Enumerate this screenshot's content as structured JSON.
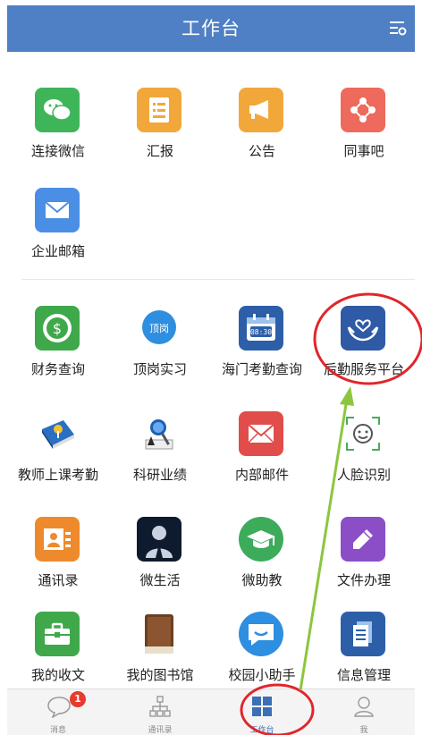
{
  "header": {
    "title": "工作台"
  },
  "section1": [
    {
      "label": "连接微信",
      "icon": "wechat-icon",
      "color": "#3fb55a"
    },
    {
      "label": "汇报",
      "icon": "report-icon",
      "color": "#f2a73b"
    },
    {
      "label": "公告",
      "icon": "megaphone-icon",
      "color": "#f2a73b"
    },
    {
      "label": "同事吧",
      "icon": "colleague-icon",
      "color": "#ee6a5c"
    },
    {
      "label": "企业邮箱",
      "icon": "mail-icon",
      "color": "#4b8ee6"
    }
  ],
  "section2": [
    {
      "label": "财务查询",
      "icon": "finance-icon"
    },
    {
      "label": "顶岗实习",
      "icon": "internship-icon",
      "badge_text": "顶岗"
    },
    {
      "label": "海门考勤查询",
      "icon": "attendance-icon",
      "clock_text": "08:30"
    },
    {
      "label": "后勤服务平台",
      "icon": "logistics-icon"
    },
    {
      "label": "教师上课考勤",
      "icon": "teacher-attendance-icon"
    },
    {
      "label": "科研业绩",
      "icon": "research-icon"
    },
    {
      "label": "内部邮件",
      "icon": "internal-mail-icon"
    },
    {
      "label": "人脸识别",
      "icon": "face-recognition-icon"
    },
    {
      "label": "通讯录",
      "icon": "contacts-icon"
    },
    {
      "label": "微生活",
      "icon": "micro-life-icon"
    },
    {
      "label": "微助教",
      "icon": "teaching-assistant-icon"
    },
    {
      "label": "文件办理",
      "icon": "file-handling-icon"
    },
    {
      "label": "我的收文",
      "icon": "received-docs-icon"
    },
    {
      "label": "我的图书馆",
      "icon": "library-icon"
    },
    {
      "label": "校园小助手",
      "icon": "campus-assistant-icon"
    },
    {
      "label": "信息管理",
      "icon": "info-management-icon"
    }
  ],
  "tabs": [
    {
      "label": "消息",
      "icon": "message-icon",
      "badge": "1"
    },
    {
      "label": "通讯录",
      "icon": "org-chart-icon"
    },
    {
      "label": "工作台",
      "icon": "workbench-icon",
      "active": true
    },
    {
      "label": "我",
      "icon": "profile-icon"
    }
  ],
  "colors": {
    "header": "#4f7fc4",
    "annotation": "#e0262b",
    "arrow": "#8cc63f",
    "active_tab": "#3d6fb6"
  }
}
